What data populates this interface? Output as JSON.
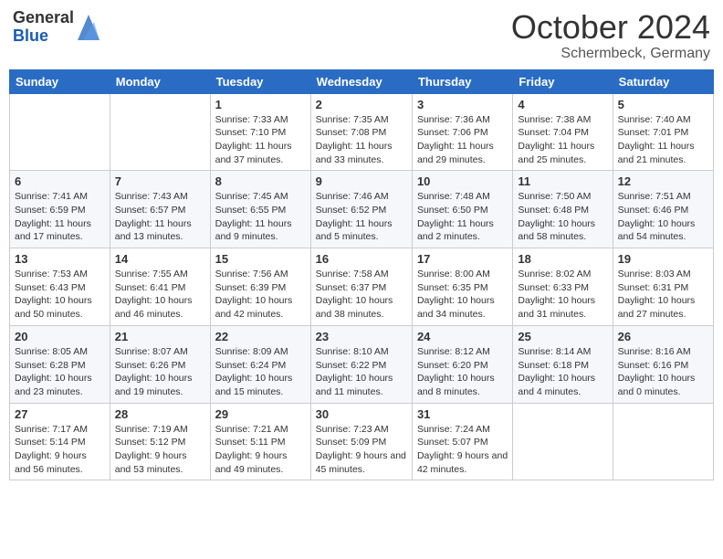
{
  "header": {
    "logo_general": "General",
    "logo_blue": "Blue",
    "month_title": "October 2024",
    "location": "Schermbeck, Germany"
  },
  "weekdays": [
    "Sunday",
    "Monday",
    "Tuesday",
    "Wednesday",
    "Thursday",
    "Friday",
    "Saturday"
  ],
  "weeks": [
    [
      {
        "day": "",
        "detail": ""
      },
      {
        "day": "",
        "detail": ""
      },
      {
        "day": "1",
        "detail": "Sunrise: 7:33 AM\nSunset: 7:10 PM\nDaylight: 11 hours and 37 minutes."
      },
      {
        "day": "2",
        "detail": "Sunrise: 7:35 AM\nSunset: 7:08 PM\nDaylight: 11 hours and 33 minutes."
      },
      {
        "day": "3",
        "detail": "Sunrise: 7:36 AM\nSunset: 7:06 PM\nDaylight: 11 hours and 29 minutes."
      },
      {
        "day": "4",
        "detail": "Sunrise: 7:38 AM\nSunset: 7:04 PM\nDaylight: 11 hours and 25 minutes."
      },
      {
        "day": "5",
        "detail": "Sunrise: 7:40 AM\nSunset: 7:01 PM\nDaylight: 11 hours and 21 minutes."
      }
    ],
    [
      {
        "day": "6",
        "detail": "Sunrise: 7:41 AM\nSunset: 6:59 PM\nDaylight: 11 hours and 17 minutes."
      },
      {
        "day": "7",
        "detail": "Sunrise: 7:43 AM\nSunset: 6:57 PM\nDaylight: 11 hours and 13 minutes."
      },
      {
        "day": "8",
        "detail": "Sunrise: 7:45 AM\nSunset: 6:55 PM\nDaylight: 11 hours and 9 minutes."
      },
      {
        "day": "9",
        "detail": "Sunrise: 7:46 AM\nSunset: 6:52 PM\nDaylight: 11 hours and 5 minutes."
      },
      {
        "day": "10",
        "detail": "Sunrise: 7:48 AM\nSunset: 6:50 PM\nDaylight: 11 hours and 2 minutes."
      },
      {
        "day": "11",
        "detail": "Sunrise: 7:50 AM\nSunset: 6:48 PM\nDaylight: 10 hours and 58 minutes."
      },
      {
        "day": "12",
        "detail": "Sunrise: 7:51 AM\nSunset: 6:46 PM\nDaylight: 10 hours and 54 minutes."
      }
    ],
    [
      {
        "day": "13",
        "detail": "Sunrise: 7:53 AM\nSunset: 6:43 PM\nDaylight: 10 hours and 50 minutes."
      },
      {
        "day": "14",
        "detail": "Sunrise: 7:55 AM\nSunset: 6:41 PM\nDaylight: 10 hours and 46 minutes."
      },
      {
        "day": "15",
        "detail": "Sunrise: 7:56 AM\nSunset: 6:39 PM\nDaylight: 10 hours and 42 minutes."
      },
      {
        "day": "16",
        "detail": "Sunrise: 7:58 AM\nSunset: 6:37 PM\nDaylight: 10 hours and 38 minutes."
      },
      {
        "day": "17",
        "detail": "Sunrise: 8:00 AM\nSunset: 6:35 PM\nDaylight: 10 hours and 34 minutes."
      },
      {
        "day": "18",
        "detail": "Sunrise: 8:02 AM\nSunset: 6:33 PM\nDaylight: 10 hours and 31 minutes."
      },
      {
        "day": "19",
        "detail": "Sunrise: 8:03 AM\nSunset: 6:31 PM\nDaylight: 10 hours and 27 minutes."
      }
    ],
    [
      {
        "day": "20",
        "detail": "Sunrise: 8:05 AM\nSunset: 6:28 PM\nDaylight: 10 hours and 23 minutes."
      },
      {
        "day": "21",
        "detail": "Sunrise: 8:07 AM\nSunset: 6:26 PM\nDaylight: 10 hours and 19 minutes."
      },
      {
        "day": "22",
        "detail": "Sunrise: 8:09 AM\nSunset: 6:24 PM\nDaylight: 10 hours and 15 minutes."
      },
      {
        "day": "23",
        "detail": "Sunrise: 8:10 AM\nSunset: 6:22 PM\nDaylight: 10 hours and 11 minutes."
      },
      {
        "day": "24",
        "detail": "Sunrise: 8:12 AM\nSunset: 6:20 PM\nDaylight: 10 hours and 8 minutes."
      },
      {
        "day": "25",
        "detail": "Sunrise: 8:14 AM\nSunset: 6:18 PM\nDaylight: 10 hours and 4 minutes."
      },
      {
        "day": "26",
        "detail": "Sunrise: 8:16 AM\nSunset: 6:16 PM\nDaylight: 10 hours and 0 minutes."
      }
    ],
    [
      {
        "day": "27",
        "detail": "Sunrise: 7:17 AM\nSunset: 5:14 PM\nDaylight: 9 hours and 56 minutes."
      },
      {
        "day": "28",
        "detail": "Sunrise: 7:19 AM\nSunset: 5:12 PM\nDaylight: 9 hours and 53 minutes."
      },
      {
        "day": "29",
        "detail": "Sunrise: 7:21 AM\nSunset: 5:11 PM\nDaylight: 9 hours and 49 minutes."
      },
      {
        "day": "30",
        "detail": "Sunrise: 7:23 AM\nSunset: 5:09 PM\nDaylight: 9 hours and 45 minutes."
      },
      {
        "day": "31",
        "detail": "Sunrise: 7:24 AM\nSunset: 5:07 PM\nDaylight: 9 hours and 42 minutes."
      },
      {
        "day": "",
        "detail": ""
      },
      {
        "day": "",
        "detail": ""
      }
    ]
  ]
}
